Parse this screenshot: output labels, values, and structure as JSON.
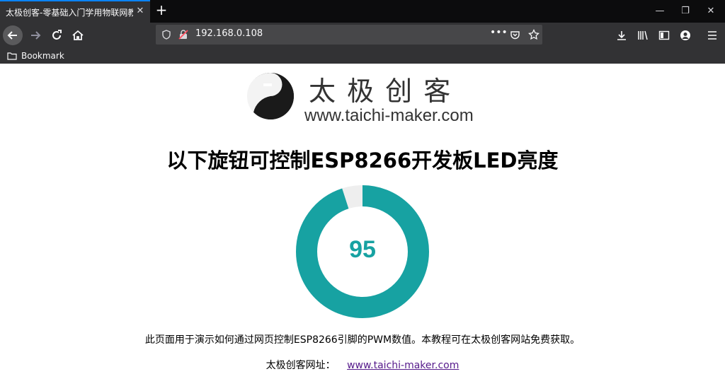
{
  "browser": {
    "tab_title": "太极创客-零基础入门学用物联网教",
    "url": "192.168.0.108",
    "bookmark_label": "Bookmark"
  },
  "page": {
    "logo_cn": "太 极 创 客",
    "logo_url": "www.taichi-maker.com",
    "heading": "以下旋钮可控制ESP8266开发板LED亮度",
    "knob_value": "95",
    "knob_fraction": 0.95,
    "knob_color": "#17a2a2",
    "knob_track_color": "#eeeeee",
    "description": "此页面用于演示如何通过网页控制ESP8266引脚的PWM数值。本教程可在太极创客网站免费获取。",
    "site_label": "太极创客网址：",
    "site_link": "www.taichi-maker.com"
  }
}
